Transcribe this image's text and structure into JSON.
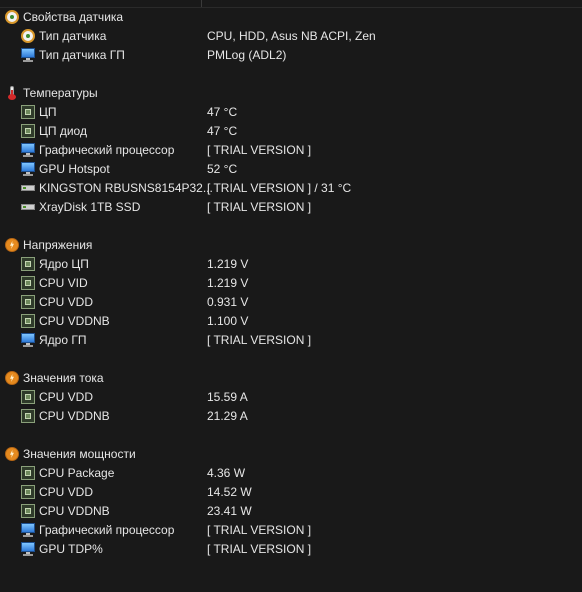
{
  "groups": [
    {
      "title": "Свойства датчика",
      "icon": "sensor-icon",
      "items": [
        {
          "label": "Тип датчика",
          "value": "CPU, HDD, Asus NB ACPI, Zen",
          "icon": "sensor-icon"
        },
        {
          "label": "Тип датчика ГП",
          "value": "PMLog  (ADL2)",
          "icon": "monitor-icon"
        }
      ]
    },
    {
      "title": "Температуры",
      "icon": "thermometer-icon",
      "items": [
        {
          "label": "ЦП",
          "value": "47 °C",
          "icon": "chip-icon"
        },
        {
          "label": "ЦП диод",
          "value": "47 °C",
          "icon": "chip-icon"
        },
        {
          "label": "Графический процессор",
          "value": "[ TRIAL VERSION ]",
          "icon": "monitor-icon"
        },
        {
          "label": "GPU Hotspot",
          "value": "52 °C",
          "icon": "monitor-icon"
        },
        {
          "label": "KINGSTON RBUSNS8154P32...",
          "value": "[ TRIAL VERSION ] / 31 °C",
          "icon": "disk-icon"
        },
        {
          "label": "XrayDisk 1TB SSD",
          "value": "[ TRIAL VERSION ]",
          "icon": "disk-icon"
        }
      ]
    },
    {
      "title": "Напряжения",
      "icon": "voltage-icon",
      "items": [
        {
          "label": "Ядро ЦП",
          "value": "1.219 V",
          "icon": "chip-icon"
        },
        {
          "label": "CPU VID",
          "value": "1.219 V",
          "icon": "chip-icon"
        },
        {
          "label": "CPU VDD",
          "value": "0.931 V",
          "icon": "chip-icon"
        },
        {
          "label": "CPU VDDNB",
          "value": "1.100 V",
          "icon": "chip-icon"
        },
        {
          "label": "Ядро ГП",
          "value": "[ TRIAL VERSION ]",
          "icon": "monitor-icon"
        }
      ]
    },
    {
      "title": "Значения тока",
      "icon": "current-icon",
      "items": [
        {
          "label": "CPU VDD",
          "value": "15.59 A",
          "icon": "chip-icon"
        },
        {
          "label": "CPU VDDNB",
          "value": "21.29 A",
          "icon": "chip-icon"
        }
      ]
    },
    {
      "title": "Значения мощности",
      "icon": "power-icon",
      "items": [
        {
          "label": "CPU Package",
          "value": "4.36 W",
          "icon": "chip-icon"
        },
        {
          "label": "CPU VDD",
          "value": "14.52 W",
          "icon": "chip-icon"
        },
        {
          "label": "CPU VDDNB",
          "value": "23.41 W",
          "icon": "chip-icon"
        },
        {
          "label": "Графический процессор",
          "value": "[ TRIAL VERSION ]",
          "icon": "monitor-icon"
        },
        {
          "label": "GPU TDP%",
          "value": "[ TRIAL VERSION ]",
          "icon": "monitor-icon"
        }
      ]
    }
  ]
}
